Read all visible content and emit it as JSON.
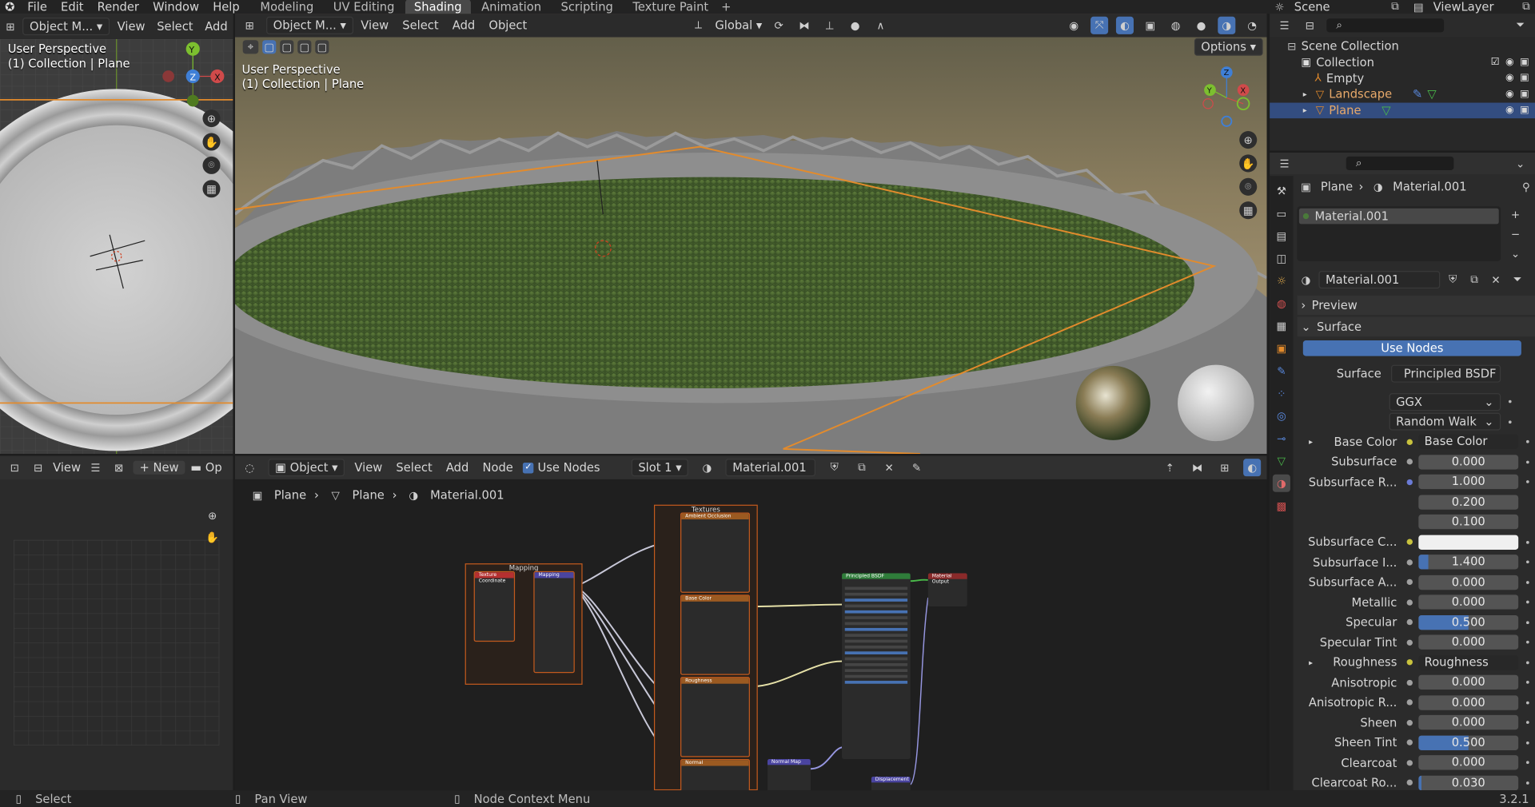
{
  "topbar": {
    "menu": [
      "File",
      "Edit",
      "Render",
      "Window",
      "Help"
    ],
    "workspaces": [
      "Modeling",
      "UV Editing",
      "Shading",
      "Animation",
      "Scripting",
      "Texture Paint"
    ],
    "active_workspace": "Shading",
    "add_tab": "+",
    "scene": "Scene",
    "view_layer": "ViewLayer"
  },
  "left_viewport": {
    "mode": "Object M...",
    "menu": [
      "View",
      "Select",
      "Add"
    ],
    "overlay_line1": "User Perspective",
    "overlay_line2": "(1) Collection | Plane",
    "gizmo_x": "X",
    "gizmo_y": "Y",
    "gizmo_z": "Z"
  },
  "main_viewport": {
    "mode": "Object M...",
    "menu": [
      "View",
      "Select",
      "Add",
      "Object"
    ],
    "transform_orientation": "Global",
    "options": "Options",
    "overlay_line1": "User Perspective",
    "overlay_line2": "(1) Collection | Plane",
    "gizmo_x": "X",
    "gizmo_y": "Y",
    "gizmo_z": "Z"
  },
  "image_editor": {
    "view": "View",
    "new": "New",
    "open": "Op"
  },
  "node_editor": {
    "object_type": "Object",
    "menu": [
      "View",
      "Select",
      "Add",
      "Node"
    ],
    "use_nodes": "Use Nodes",
    "slot": "Slot 1",
    "material": "Material.001",
    "breadcrumb": [
      "Plane",
      "Plane",
      "Material.001"
    ],
    "frames": {
      "textures": "Textures",
      "mapping": "Mapping"
    },
    "nodes": {
      "tex_coord": "Texture Coordinate",
      "mapping": "Mapping",
      "ao": "Ambient Occlusion",
      "base_color": "Base Color",
      "roughness": "Roughness",
      "normal": "Normal",
      "normal_map": "Normal Map",
      "principled": "Principled BSDF",
      "material_output": "Material Output",
      "displacement": "Displacement"
    }
  },
  "outliner": {
    "items": [
      {
        "label": "Scene Collection",
        "depth": 0
      },
      {
        "label": "Collection",
        "depth": 1
      },
      {
        "label": "Empty",
        "depth": 2
      },
      {
        "label": "Landscape",
        "depth": 2
      },
      {
        "label": "Plane",
        "depth": 2,
        "selected": true
      }
    ]
  },
  "properties": {
    "breadcrumb_object": "Plane",
    "breadcrumb_material": "Material.001",
    "slot_material": "Material.001",
    "material_name": "Material.001",
    "preview": "Preview",
    "surface_panel": "Surface",
    "use_nodes": "Use Nodes",
    "surface_label": "Surface",
    "surface_value": "Principled BSDF",
    "distribution": "GGX",
    "subsurface_method": "Random Walk",
    "params": [
      {
        "label": "Base Color",
        "value": "Base Color",
        "kind": "link",
        "expand": true
      },
      {
        "label": "Subsurface",
        "value": "0.000",
        "kind": "num"
      },
      {
        "label": "Subsurface R...",
        "value": "1.000",
        "kind": "num",
        "dotcolor": "#6b7bd6"
      },
      {
        "label": "",
        "value": "0.200",
        "kind": "num",
        "nodot": true
      },
      {
        "label": "",
        "value": "0.100",
        "kind": "num",
        "nodot": true
      },
      {
        "label": "Subsurface C...",
        "value": "",
        "kind": "color"
      },
      {
        "label": "Subsurface I...",
        "value": "1.400",
        "kind": "num",
        "fill": 0.1
      },
      {
        "label": "Subsurface A...",
        "value": "0.000",
        "kind": "num"
      },
      {
        "label": "Metallic",
        "value": "0.000",
        "kind": "num"
      },
      {
        "label": "Specular",
        "value": "0.500",
        "kind": "num",
        "fill": 0.5
      },
      {
        "label": "Specular Tint",
        "value": "0.000",
        "kind": "num"
      },
      {
        "label": "Roughness",
        "value": "Roughness",
        "kind": "link",
        "expand": true
      },
      {
        "label": "Anisotropic",
        "value": "0.000",
        "kind": "num"
      },
      {
        "label": "Anisotropic R...",
        "value": "0.000",
        "kind": "num"
      },
      {
        "label": "Sheen",
        "value": "0.000",
        "kind": "num"
      },
      {
        "label": "Sheen Tint",
        "value": "0.500",
        "kind": "num",
        "fill": 0.5
      },
      {
        "label": "Clearcoat",
        "value": "0.000",
        "kind": "num"
      },
      {
        "label": "Clearcoat Ro...",
        "value": "0.030",
        "kind": "num",
        "fill": 0.03
      }
    ]
  },
  "statusbar": {
    "select": "Select",
    "pan_view": "Pan View",
    "node_context": "Node Context Menu",
    "version": "3.2.1"
  }
}
